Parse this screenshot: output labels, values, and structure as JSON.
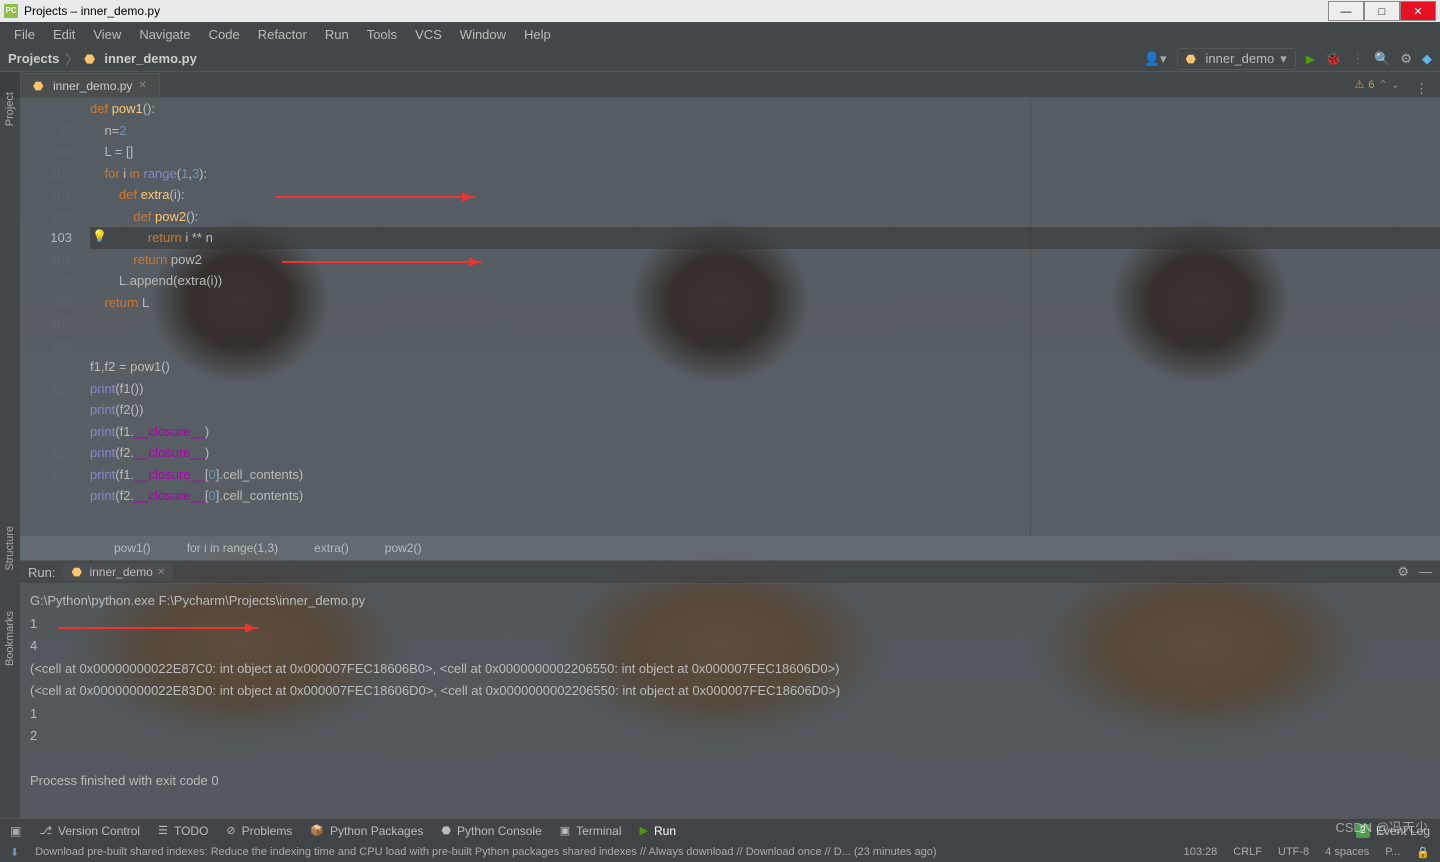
{
  "window": {
    "title": "Projects – inner_demo.py"
  },
  "menu": [
    "File",
    "Edit",
    "View",
    "Navigate",
    "Code",
    "Refactor",
    "Run",
    "Tools",
    "VCS",
    "Window",
    "Help"
  ],
  "breadcrumbs": {
    "root": "Projects",
    "file": "inner_demo.py"
  },
  "run_config": "inner_demo",
  "editor": {
    "tab_file": "inner_demo.py",
    "warnings": "6",
    "active_line": "103",
    "lines": [
      {
        "n": "",
        "t": "def pow1():",
        "indent": 0
      },
      {
        "n": "98",
        "t": "    n=2",
        "indent": 0
      },
      {
        "n": "99",
        "t": "    L = []",
        "indent": 0
      },
      {
        "n": "100",
        "t": "    for i in range(1,3):",
        "indent": 0
      },
      {
        "n": "101",
        "t": "        def extra(i):",
        "indent": 0
      },
      {
        "n": "102",
        "t": "            def pow2():",
        "indent": 0
      },
      {
        "n": "103",
        "t": "                return i ** n",
        "indent": 0
      },
      {
        "n": "104",
        "t": "            return pow2",
        "indent": 0
      },
      {
        "n": "105",
        "t": "        L.append(extra(i))",
        "indent": 0
      },
      {
        "n": "106",
        "t": "    return L",
        "indent": 0
      },
      {
        "n": "107",
        "t": "",
        "indent": 0
      },
      {
        "n": "108",
        "t": "",
        "indent": 0
      },
      {
        "n": "109",
        "t": "f1,f2 = pow1()",
        "indent": 0
      },
      {
        "n": "110",
        "t": "print(f1())",
        "indent": 0
      },
      {
        "n": "111",
        "t": "print(f2())",
        "indent": 0
      },
      {
        "n": "112",
        "t": "print(f1.__closure__)",
        "indent": 0
      },
      {
        "n": "113",
        "t": "print(f2.__closure__)",
        "indent": 0
      },
      {
        "n": "114",
        "t": "print(f1.__closure__[0].cell_contents)",
        "indent": 0
      },
      {
        "n": "115",
        "t": "print(f2.__closure__[0].cell_contents)",
        "indent": 0
      }
    ],
    "crumbs": [
      "pow1()",
      "for i in range(1,3)",
      "extra()",
      "pow2()"
    ]
  },
  "left_tools": [
    "Project",
    "Structure",
    "Bookmarks"
  ],
  "run": {
    "title": "Run:",
    "tab": "inner_demo",
    "output": [
      "G:\\Python\\python.exe F:\\Pycharm\\Projects\\inner_demo.py",
      "1",
      "4",
      "(<cell at 0x00000000022E87C0: int object at 0x000007FEC18606B0>, <cell at 0x0000000002206550: int object at 0x000007FEC18606D0>)",
      "(<cell at 0x00000000022E83D0: int object at 0x000007FEC18606D0>, <cell at 0x0000000002206550: int object at 0x000007FEC18606D0>)",
      "1",
      "2",
      "",
      "Process finished with exit code 0"
    ]
  },
  "bottom_tools": [
    "Version Control",
    "TODO",
    "Problems",
    "Python Packages",
    "Python Console",
    "Terminal",
    "Run"
  ],
  "event_log": {
    "count": "2",
    "label": "Event Log"
  },
  "status": {
    "msg": "Download pre-built shared indexes: Reduce the indexing time and CPU load with pre-built Python packages shared indexes // Always download // Download once // D... (23 minutes ago)",
    "pos": "103:28",
    "eol": "CRLF",
    "enc": "UTF-8",
    "indent": "4 spaces",
    "interp": "P..."
  },
  "watermark": "CSDN @冯天少"
}
